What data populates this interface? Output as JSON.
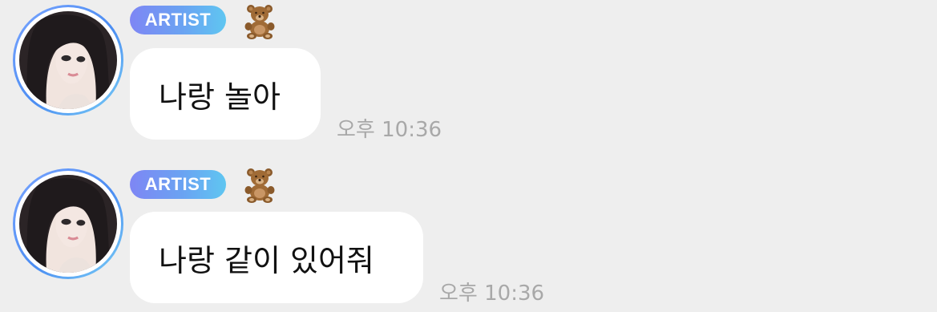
{
  "messages": [
    {
      "badge": "ARTIST",
      "text": "나랑 놀아",
      "time": "오후 10:36"
    },
    {
      "badge": "ARTIST",
      "text": "나랑 같이 있어줘",
      "time": "오후 10:36"
    }
  ],
  "colors": {
    "background": "#eeeeee",
    "bubble": "#ffffff",
    "badge_start": "#7e86f4",
    "badge_end": "#5fc6f1",
    "timestamp": "#a8a8a8"
  },
  "icons": {
    "badge_emoji": "teddy-bear-icon"
  }
}
